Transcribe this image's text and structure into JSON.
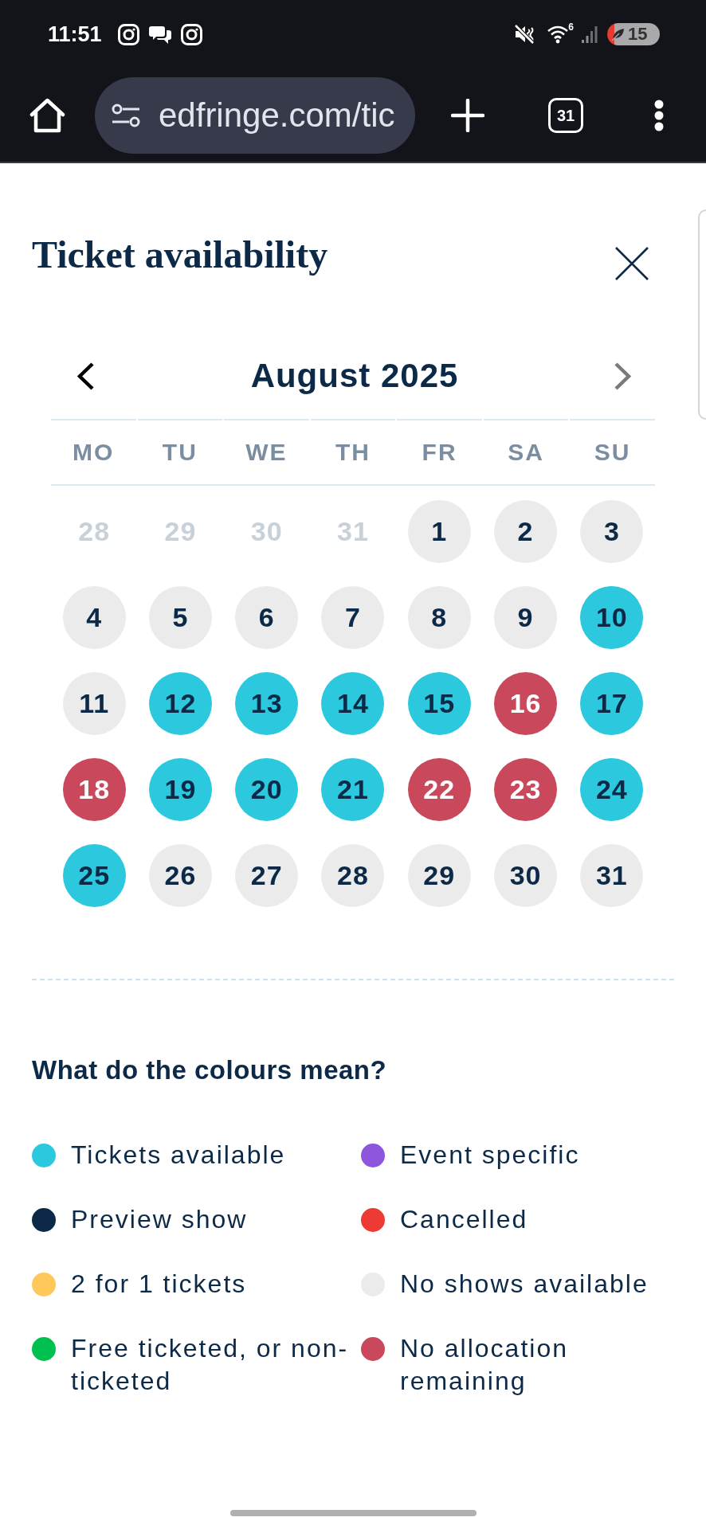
{
  "status_bar": {
    "time": "11:51",
    "wifi_badge": "6",
    "battery": "15"
  },
  "browser": {
    "url": "edfringe.com/tic",
    "tab_count": "31"
  },
  "dialog": {
    "title": "Ticket availability"
  },
  "calendar": {
    "month": "August 2025",
    "prev": {
      "disabled": false
    },
    "next": {
      "disabled": true
    },
    "weekdays": [
      "MO",
      "TU",
      "WE",
      "TH",
      "FR",
      "SA",
      "SU"
    ],
    "days": [
      {
        "day": "28",
        "kind": "other_month"
      },
      {
        "day": "29",
        "kind": "other_month"
      },
      {
        "day": "30",
        "kind": "other_month"
      },
      {
        "day": "31",
        "kind": "other_month"
      },
      {
        "day": "1",
        "kind": "day",
        "color": "#ebebeb"
      },
      {
        "day": "2",
        "kind": "day",
        "color": "#ebebeb"
      },
      {
        "day": "3",
        "kind": "day",
        "color": "#ebebeb"
      },
      {
        "day": "4",
        "kind": "day",
        "color": "#ebebeb"
      },
      {
        "day": "5",
        "kind": "day",
        "color": "#ebebeb"
      },
      {
        "day": "6",
        "kind": "day",
        "color": "#ebebeb"
      },
      {
        "day": "7",
        "kind": "day",
        "color": "#ebebeb"
      },
      {
        "day": "8",
        "kind": "day",
        "color": "#ebebeb"
      },
      {
        "day": "9",
        "kind": "day",
        "color": "#ebebeb"
      },
      {
        "day": "10",
        "kind": "day",
        "color": "#2cc8dd"
      },
      {
        "day": "11",
        "kind": "day",
        "color": "#ebebeb"
      },
      {
        "day": "12",
        "kind": "day",
        "color": "#2cc8dd"
      },
      {
        "day": "13",
        "kind": "day",
        "color": "#2cc8dd"
      },
      {
        "day": "14",
        "kind": "day",
        "color": "#2cc8dd"
      },
      {
        "day": "15",
        "kind": "day",
        "color": "#2cc8dd"
      },
      {
        "day": "16",
        "kind": "day",
        "color": "#c9485b"
      },
      {
        "day": "17",
        "kind": "day",
        "color": "#2cc8dd"
      },
      {
        "day": "18",
        "kind": "day",
        "color": "#c9485b"
      },
      {
        "day": "19",
        "kind": "day",
        "color": "#2cc8dd"
      },
      {
        "day": "20",
        "kind": "day",
        "color": "#2cc8dd"
      },
      {
        "day": "21",
        "kind": "day",
        "color": "#2cc8dd"
      },
      {
        "day": "22",
        "kind": "day",
        "color": "#c9485b"
      },
      {
        "day": "23",
        "kind": "day",
        "color": "#c9485b"
      },
      {
        "day": "24",
        "kind": "day",
        "color": "#2cc8dd"
      },
      {
        "day": "25",
        "kind": "day",
        "color": "#2cc8dd"
      },
      {
        "day": "26",
        "kind": "day",
        "color": "#ebebeb"
      },
      {
        "day": "27",
        "kind": "day",
        "color": "#ebebeb"
      },
      {
        "day": "28",
        "kind": "day",
        "color": "#ebebeb"
      },
      {
        "day": "29",
        "kind": "day",
        "color": "#ebebeb"
      },
      {
        "day": "30",
        "kind": "day",
        "color": "#ebebeb"
      },
      {
        "day": "31",
        "kind": "day",
        "color": "#ebebeb"
      }
    ]
  },
  "legend": {
    "title": "What do the colours mean?",
    "items": [
      {
        "label": "Tickets available",
        "color": "#2cc8dd"
      },
      {
        "label": "Event specific",
        "color": "#8e55dd"
      },
      {
        "label": "Preview show",
        "color": "#0c2a47"
      },
      {
        "label": "Cancelled",
        "color": "#ee3a34"
      },
      {
        "label": "2 for 1 tickets",
        "color": "#ffc85a"
      },
      {
        "label": "No shows available",
        "color": "#ebebeb"
      },
      {
        "label": "Free ticketed, or non-ticketed",
        "color": "#00c04f"
      },
      {
        "label": "No allocation remaining",
        "color": "#c9485b"
      }
    ]
  }
}
